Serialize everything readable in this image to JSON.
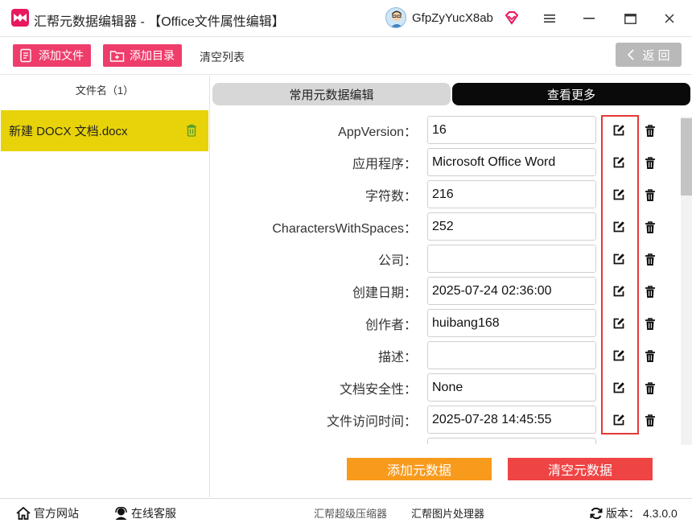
{
  "window": {
    "title": "汇帮元数据编辑器 - 【Office文件属性编辑】",
    "username": "GfpZyYucX8ab"
  },
  "toolbar": {
    "add_file": "添加文件",
    "add_dir": "添加目录",
    "clear_list": "清空列表",
    "back": "返 回"
  },
  "file_list": {
    "header": "文件名（1）",
    "files": [
      {
        "name": "新建 DOCX 文档.docx"
      }
    ]
  },
  "tabs": [
    {
      "label": "常用元数据编辑",
      "active": false
    },
    {
      "label": "查看更多",
      "active": true
    }
  ],
  "fields": [
    {
      "label": "AppVersion：",
      "value": "16"
    },
    {
      "label": "应用程序：",
      "value": "Microsoft Office Word"
    },
    {
      "label": "字符数：",
      "value": "216"
    },
    {
      "label": "CharactersWithSpaces：",
      "value": "252"
    },
    {
      "label": "公司：",
      "value": ""
    },
    {
      "label": "创建日期：",
      "value": "2025-07-24 02:36:00"
    },
    {
      "label": "创作者：",
      "value": "huibang168"
    },
    {
      "label": "描述：",
      "value": ""
    },
    {
      "label": "文档安全性：",
      "value": "None"
    },
    {
      "label": "文件访问时间：",
      "value": "2025-07-28 14:45:55"
    }
  ],
  "actions": {
    "add_metadata": "添加元数据",
    "clear_metadata": "清空元数据"
  },
  "footer": {
    "website": "官方网站",
    "support": "在线客服",
    "compressor": "汇帮超级压缩器",
    "image_tool": "汇帮图片处理器",
    "version_label": "版本：",
    "version": "4.3.0.0"
  },
  "colors": {
    "accent_pink": "#ee3d6b",
    "selected_file": "#e8d30a",
    "add_button": "#f89a1c",
    "clear_button": "#ef4444",
    "highlight_frame": "#e53935"
  }
}
